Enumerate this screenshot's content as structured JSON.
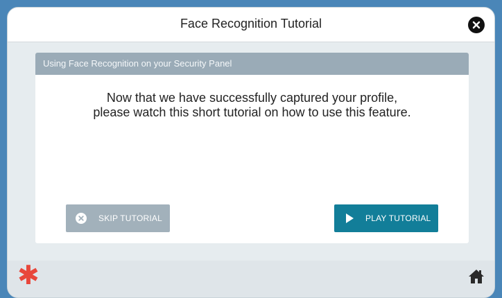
{
  "dialog": {
    "title": "Face Recognition Tutorial",
    "close_icon": "close-icon"
  },
  "panel": {
    "header": "Using Face Recognition on your Security Panel",
    "message_line1": "Now that we have successfully captured your profile,",
    "message_line2": "please watch this short tutorial on how to use this feature."
  },
  "buttons": {
    "skip_label": "SKIP TUTORIAL",
    "skip_icon": "x-circle-icon",
    "play_label": "PLAY TUTORIAL",
    "play_icon": "play-icon"
  },
  "footer": {
    "brand_icon": "asterisk-icon",
    "home_icon": "home-icon"
  },
  "colors": {
    "panel_header": "#9aabb7",
    "play_button": "#127e99",
    "skip_button": "#a2b1bb",
    "brand_accent": "#e8473b"
  }
}
